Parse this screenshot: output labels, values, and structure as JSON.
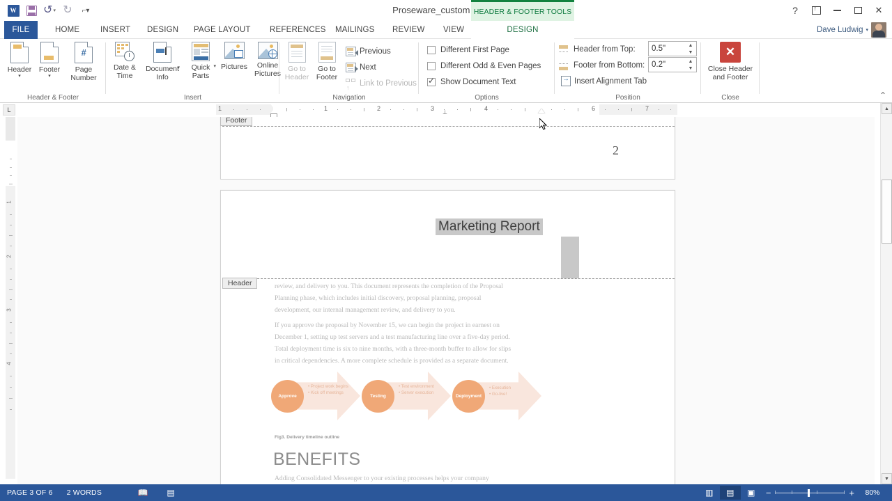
{
  "window": {
    "title": "Proseware_custom - Word",
    "app_logo": "word-logo",
    "quick_access": [
      {
        "name": "save-icon",
        "label": "Save"
      },
      {
        "name": "undo-icon",
        "label": "Undo"
      },
      {
        "name": "redo-icon",
        "label": "Repeat"
      },
      {
        "name": "customize-qat-icon",
        "label": "Customize Quick Access Toolbar"
      }
    ],
    "controls": [
      {
        "name": "help-button",
        "glyph": "?"
      },
      {
        "name": "ribbon-display-options-button",
        "glyph": "ribbon"
      },
      {
        "name": "minimize-button",
        "glyph": "minimize"
      },
      {
        "name": "restore-button",
        "glyph": "restore"
      },
      {
        "name": "close-button",
        "glyph": "✕"
      }
    ]
  },
  "contextual_tab_banner": "HEADER & FOOTER TOOLS",
  "user": {
    "name": "Dave Ludwig"
  },
  "tabs": [
    {
      "label": "FILE",
      "type": "file"
    },
    {
      "label": "HOME"
    },
    {
      "label": "INSERT"
    },
    {
      "label": "DESIGN"
    },
    {
      "label": "PAGE LAYOUT"
    },
    {
      "label": "REFERENCES"
    },
    {
      "label": "MAILINGS"
    },
    {
      "label": "REVIEW"
    },
    {
      "label": "VIEW"
    },
    {
      "label": "DESIGN",
      "active": true,
      "contextual": true
    }
  ],
  "ribbon": {
    "groups": [
      {
        "name": "header-footer",
        "label": "Header & Footer",
        "buttons": [
          {
            "label": "Header",
            "icon": "header-icon",
            "dropdown": true
          },
          {
            "label": "Footer",
            "icon": "footer-icon",
            "dropdown": true
          },
          {
            "label_1": "Page",
            "label_2": "Number",
            "icon": "page-number-icon",
            "dropdown": true
          }
        ]
      },
      {
        "name": "insert",
        "label": "Insert",
        "buttons": [
          {
            "label_1": "Date &",
            "label_2": "Time",
            "icon": "date-time-icon"
          },
          {
            "label_1": "Document",
            "label_2": "Info",
            "icon": "document-info-icon",
            "dropdown": true
          },
          {
            "label_1": "Quick",
            "label_2": "Parts",
            "icon": "quick-parts-icon",
            "dropdown": true
          },
          {
            "label": "Pictures",
            "icon": "pictures-icon"
          },
          {
            "label_1": "Online",
            "label_2": "Pictures",
            "icon": "online-pictures-icon"
          }
        ]
      },
      {
        "name": "navigation",
        "label": "Navigation",
        "buttons": [
          {
            "label_1": "Go to",
            "label_2": "Header",
            "icon": "go-to-header-icon",
            "disabled": true
          },
          {
            "label_1": "Go to",
            "label_2": "Footer",
            "icon": "go-to-footer-icon",
            "disabled": false
          }
        ],
        "commands": [
          {
            "label": "Previous",
            "icon": "previous-icon",
            "disabled": false
          },
          {
            "label": "Next",
            "icon": "next-icon",
            "disabled": false
          },
          {
            "label": "Link to Previous",
            "icon": "link-to-previous-icon",
            "disabled": true
          }
        ]
      },
      {
        "name": "options",
        "label": "Options",
        "checkboxes": [
          {
            "label": "Different First Page",
            "checked": false
          },
          {
            "label": "Different Odd & Even Pages",
            "checked": false
          },
          {
            "label": "Show Document Text",
            "checked": true
          }
        ]
      },
      {
        "name": "position",
        "label": "Position",
        "fields": [
          {
            "label": "Header from Top:",
            "value": "0.5\"",
            "icon": "header-from-top-icon"
          },
          {
            "label": "Footer from Bottom:",
            "value": "0.2\"",
            "icon": "footer-from-bottom-icon"
          }
        ],
        "commands": [
          {
            "label": "Insert Alignment Tab",
            "icon": "insert-alignment-tab-icon"
          }
        ]
      },
      {
        "name": "close",
        "label": "Close",
        "buttons": [
          {
            "label_1": "Close Header",
            "label_2": "and Footer",
            "icon": "close-header-footer-icon"
          }
        ]
      }
    ],
    "collapse_label": "Collapse the Ribbon"
  },
  "rulers": {
    "tab_stop_selector": "L",
    "horizontal_marks": [
      "1",
      "1",
      "2",
      "3",
      "4",
      "6",
      "7"
    ],
    "vertical_marks": [
      "1",
      "2",
      "3",
      "4"
    ]
  },
  "document": {
    "page_previous": {
      "footer_tag": "Footer",
      "page_number": "2"
    },
    "page_current": {
      "header_tag": "Header",
      "header_text": "Marketing Report",
      "paragraphs": [
        [
          "review, and delivery to you. This document represents the completion of the Proposal",
          "Planning phase, which includes initial discovery, proposal planning, proposal",
          "development, our internal management review, and delivery to you."
        ],
        [
          "If you approve the proposal by November 15, we can begin the project in earnest on",
          "December 1, setting up test servers and a test manufacturing line over a five-day period.",
          "Total deployment time is six to nine months, with a three-month buffer to allow for slips",
          "in critical dependencies. A more complete schedule is provided as a separate document."
        ]
      ],
      "smartart": {
        "steps": [
          {
            "title": "Approve",
            "bullets": [
              "Project work begins",
              "Kick off meetings"
            ]
          },
          {
            "title": "Testing",
            "bullets": [
              "Test environment",
              "Server execution"
            ]
          },
          {
            "title": "Deployment",
            "bullets": [
              "Execution",
              "Go-live!"
            ]
          }
        ],
        "caption": "Fig3. Delivery timeline outline"
      },
      "heading": "BENEFITS",
      "heading_body": "Adding Consolidated Messenger to your existing processes helps your company"
    }
  },
  "status_bar": {
    "page_indicator": "PAGE 3 OF 6",
    "word_count": "2 WORDS",
    "proofing_icon": "proofing-errors-icon",
    "language_icon": "macro-recording-icon",
    "views": [
      {
        "name": "read-mode-view-button",
        "glyph": "▤"
      },
      {
        "name": "print-layout-view-button",
        "glyph": "▤",
        "active": true
      },
      {
        "name": "web-layout-view-button",
        "glyph": "▤"
      }
    ],
    "zoom_out": "−",
    "zoom_in": "+",
    "zoom_level": "80%"
  },
  "colors": {
    "word_blue": "#2b579a",
    "contextual_green": "#107c41",
    "accent_orange": "#f0a877",
    "close_red": "#c9453d"
  }
}
